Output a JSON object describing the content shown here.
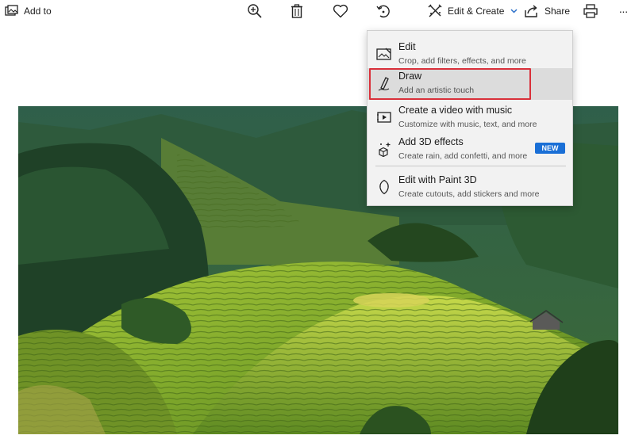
{
  "toolbar": {
    "add_to_label": "Add to",
    "edit_create_label": "Edit & Create",
    "share_label": "Share",
    "more_label": "···",
    "icons": [
      "add-to-icon",
      "zoom-icon",
      "delete-icon",
      "favorite-icon",
      "rotate-icon",
      "edit-create-icon",
      "share-icon",
      "print-icon",
      "more-icon"
    ]
  },
  "menu": {
    "items": [
      {
        "title": "Edit",
        "subtitle": "Crop, add filters, effects, and more",
        "icon": "edit-photo-icon"
      },
      {
        "title": "Draw",
        "subtitle": "Add an artistic touch",
        "icon": "pen-icon"
      },
      {
        "title": "Create a video with music",
        "subtitle": "Customize with music, text, and more",
        "icon": "video-icon"
      },
      {
        "title": "Add 3D effects",
        "subtitle": "Create rain, add confetti, and more",
        "icon": "sparkle-3d-icon",
        "badge": "NEW"
      },
      {
        "title": "Edit with Paint 3D",
        "subtitle": "Create cutouts, add stickers and more",
        "icon": "paint-3d-icon"
      }
    ]
  },
  "colors": {
    "accent": "#2a6fc9",
    "badge": "#1a6fd6",
    "highlight": "#d9303a",
    "menu_bg": "#f2f2f2"
  },
  "photo": {
    "subject": "terraced-rice-fields-landscape"
  }
}
